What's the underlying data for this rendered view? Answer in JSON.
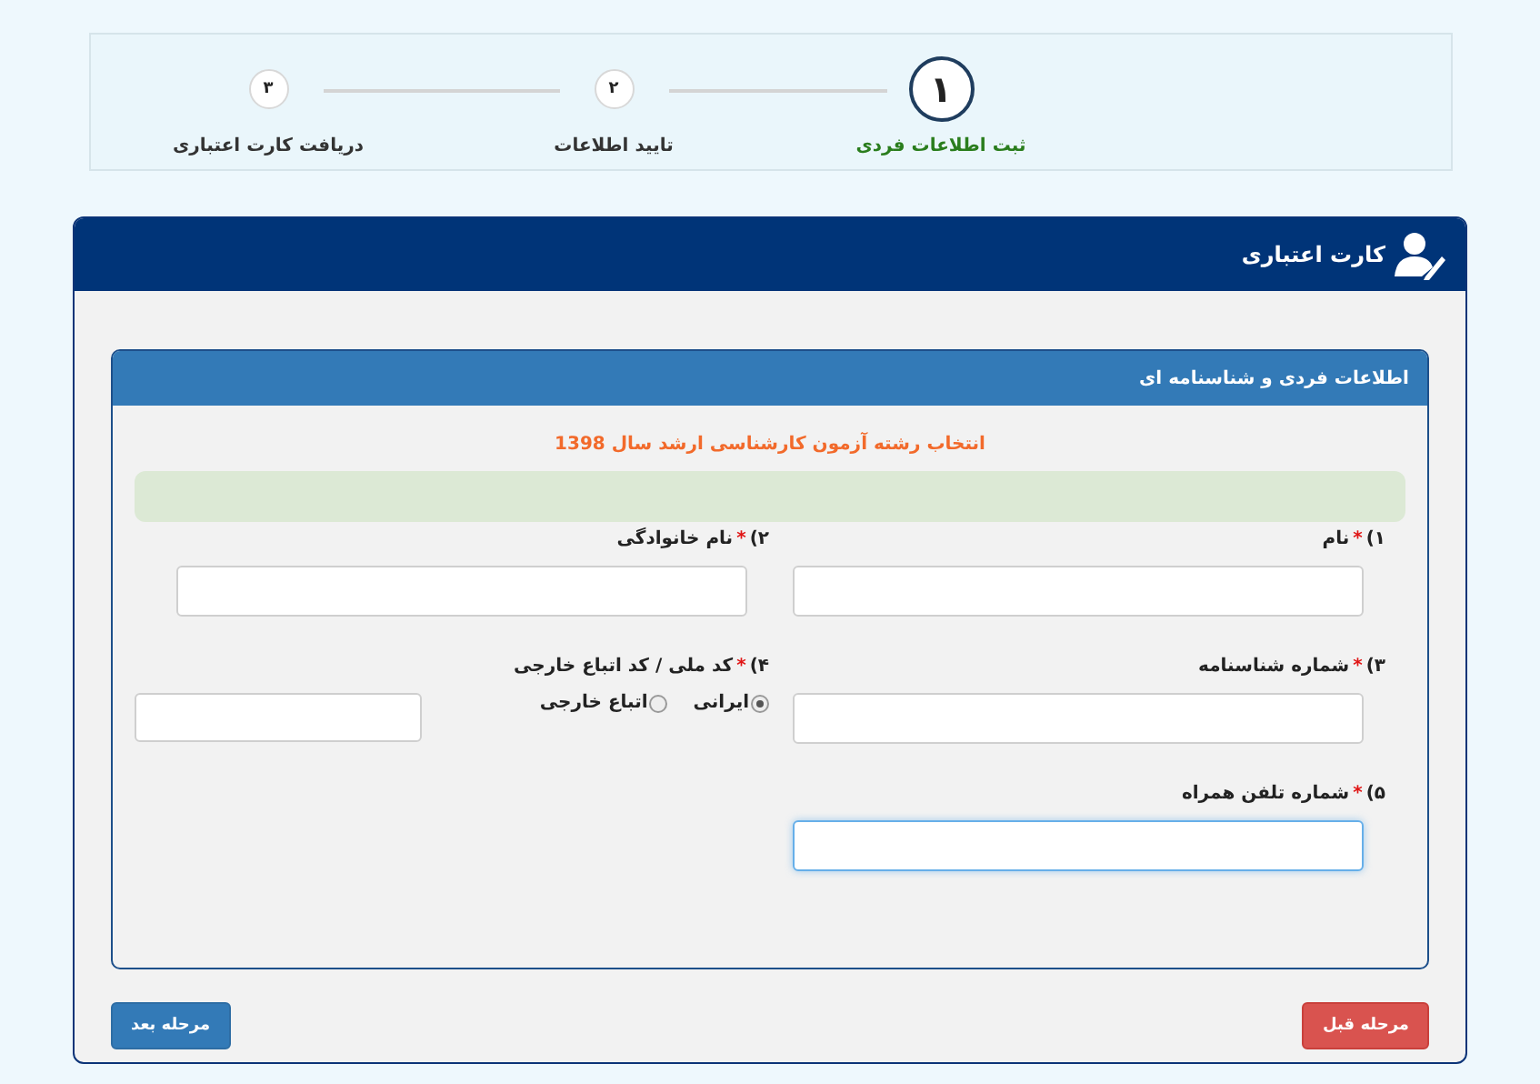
{
  "steps": [
    {
      "number": "۱",
      "label": "ثبت اطلاعات فردی",
      "selected": true
    },
    {
      "number": "۲",
      "label": "تایید اطلاعات",
      "selected": false
    },
    {
      "number": "۳",
      "label": "دریافت کارت اعتباری",
      "selected": false
    }
  ],
  "panel": {
    "title": "کارت اعتباری"
  },
  "section": {
    "title": "اطلاعات فردی و شناسنامه ای",
    "notice": "انتخاب رشته آزمون کارشناسی ارشد سال 1398"
  },
  "fields": [
    {
      "kind": "text",
      "number": "۱)",
      "required_mark": "*",
      "label": "نام",
      "focused": false
    },
    {
      "kind": "text",
      "number": "۲)",
      "required_mark": "*",
      "label": "نام خانوادگی",
      "focused": false
    },
    {
      "kind": "text",
      "number": "۳)",
      "required_mark": "*",
      "label": "شماره شناسنامه",
      "focused": false
    },
    {
      "kind": "national-id",
      "number": "۴)",
      "required_mark": "*",
      "label": "کد ملی / کد اتباع خارجی",
      "focused": false,
      "options": [
        {
          "label": "ایرانی",
          "selected": true
        },
        {
          "label": "اتباع خارجی",
          "selected": false
        }
      ]
    },
    {
      "kind": "text",
      "number": "۵)",
      "required_mark": "*",
      "label": "شماره تلفن همراه",
      "focused": true
    }
  ],
  "buttons": {
    "previous": "مرحله قبل",
    "next": "مرحله بعد"
  }
}
